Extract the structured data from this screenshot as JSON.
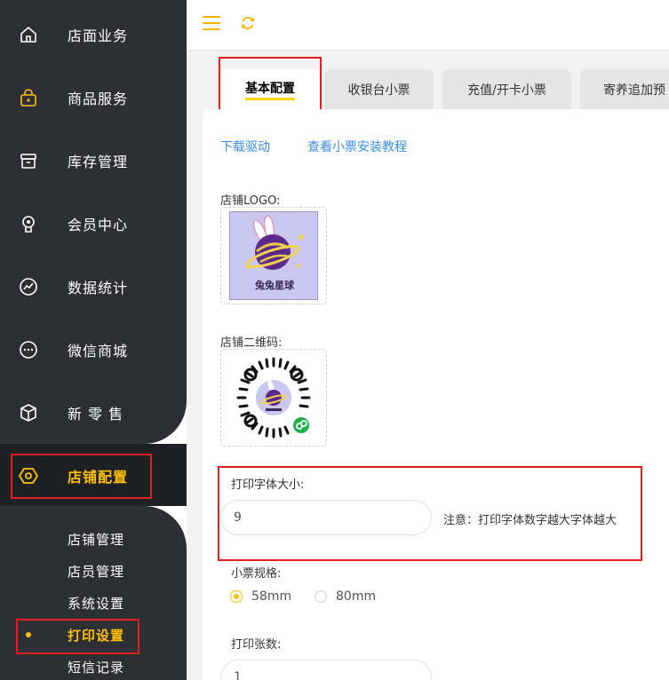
{
  "sidebar": {
    "items": [
      {
        "label": "店面业务",
        "icon": "home-icon"
      },
      {
        "label": "商品服务",
        "icon": "shopping-bag-icon"
      },
      {
        "label": "库存管理",
        "icon": "archive-box-icon"
      },
      {
        "label": "会员中心",
        "icon": "member-badge-icon"
      },
      {
        "label": "数据统计",
        "icon": "chart-line-icon"
      },
      {
        "label": "微信商城",
        "icon": "chat-bubble-icon"
      },
      {
        "label": "新 零 售",
        "icon": "cube-icon"
      },
      {
        "label": "店铺配置",
        "icon": "hexagon-settings-icon",
        "active": true
      }
    ],
    "sub_items": [
      {
        "label": "店铺管理"
      },
      {
        "label": "店员管理"
      },
      {
        "label": "系统设置"
      },
      {
        "label": "打印设置",
        "active": true
      },
      {
        "label": "短信记录"
      }
    ]
  },
  "topbar": {
    "menu_icon": "hamburger-menu-icon",
    "refresh_icon": "refresh-icon"
  },
  "tabs": [
    {
      "label": "基本配置",
      "active": true
    },
    {
      "label": "收银台小票"
    },
    {
      "label": "充值/开卡小票"
    },
    {
      "label": "寄养追加预"
    }
  ],
  "links": {
    "download": "下载驱动",
    "tutorial": "查看小票安装教程"
  },
  "logo": {
    "label": "店铺LOGO:",
    "brand_text": "兔兔星球"
  },
  "qrcode": {
    "label": "店铺二维码:"
  },
  "font_size": {
    "label": "打印字体大小:",
    "value": "9",
    "note": "注意：打印字体数字越大字体越大"
  },
  "paper": {
    "label": "小票规格:",
    "options": [
      "58mm",
      "80mm"
    ],
    "selected": "58mm"
  },
  "copies": {
    "label": "打印张数:",
    "value": "1"
  },
  "colors": {
    "accent": "#ffc107",
    "sidebar_bg": "#2e2f34",
    "link": "#3a8ee6",
    "highlight_border": "#e02020"
  }
}
